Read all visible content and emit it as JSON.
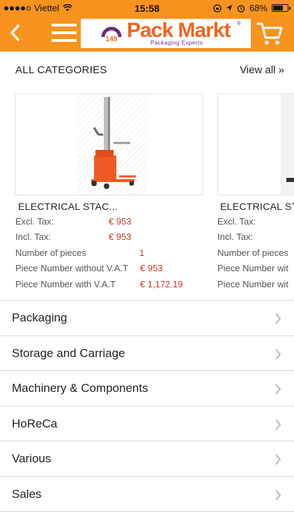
{
  "status_bar": {
    "carrier": "Viettel",
    "time": "15:58",
    "battery": "68%",
    "battery_level": 0.68
  },
  "nav": {
    "back_icon": "chevron-left-icon",
    "menu_icon": "hamburger-menu-icon",
    "logo": {
      "name": "Pack Markt",
      "tagline": "Packaging Experts",
      "mark_text": "149"
    },
    "cart_icon": "shopping-cart-icon"
  },
  "section": {
    "title": "ALL CATEGORIES",
    "view_all": "View all »"
  },
  "products": [
    {
      "name": "ELECTRICAL STAC...",
      "excl_tax_label": "Excl. Tax:",
      "excl_tax": "€ 953",
      "incl_tax_label": "Incl. Tax:",
      "incl_tax": "€ 953",
      "pieces_label": "Number of pieces",
      "pieces": "1",
      "piece_no_vat_label": "Piece Number without V.A.T",
      "piece_no_vat": "€ 953",
      "piece_vat_label": "Piece Number with V.A.T",
      "piece_vat": "€ 1,172.19"
    },
    {
      "name": "ELECTRICAL ST",
      "excl_tax_label": "Excl. Tax:",
      "incl_tax_label": "Incl. Tax:",
      "pieces_label": "Number of pieces",
      "piece_no_vat_label": "Piece Number wit",
      "piece_vat_label": "Piece Number wit"
    }
  ],
  "categories": [
    {
      "label": "Packaging"
    },
    {
      "label": "Storage and Carriage"
    },
    {
      "label": "Machinery & Components"
    },
    {
      "label": "HoReCa"
    },
    {
      "label": "Various"
    },
    {
      "label": "Sales"
    }
  ],
  "colors": {
    "header": "#f7931e",
    "price": "#c0392b",
    "logo_orange": "#f26522",
    "logo_purple": "#6b2c7a"
  }
}
